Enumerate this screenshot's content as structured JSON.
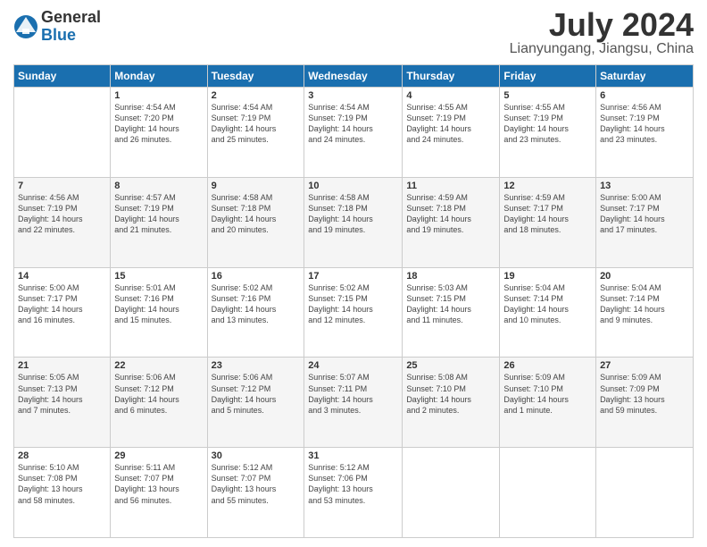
{
  "header": {
    "logo_general": "General",
    "logo_blue": "Blue",
    "title": "July 2024",
    "location": "Lianyungang, Jiangsu, China"
  },
  "days_of_week": [
    "Sunday",
    "Monday",
    "Tuesday",
    "Wednesday",
    "Thursday",
    "Friday",
    "Saturday"
  ],
  "weeks": [
    [
      {
        "num": "",
        "info": ""
      },
      {
        "num": "1",
        "info": "Sunrise: 4:54 AM\nSunset: 7:20 PM\nDaylight: 14 hours\nand 26 minutes."
      },
      {
        "num": "2",
        "info": "Sunrise: 4:54 AM\nSunset: 7:19 PM\nDaylight: 14 hours\nand 25 minutes."
      },
      {
        "num": "3",
        "info": "Sunrise: 4:54 AM\nSunset: 7:19 PM\nDaylight: 14 hours\nand 24 minutes."
      },
      {
        "num": "4",
        "info": "Sunrise: 4:55 AM\nSunset: 7:19 PM\nDaylight: 14 hours\nand 24 minutes."
      },
      {
        "num": "5",
        "info": "Sunrise: 4:55 AM\nSunset: 7:19 PM\nDaylight: 14 hours\nand 23 minutes."
      },
      {
        "num": "6",
        "info": "Sunrise: 4:56 AM\nSunset: 7:19 PM\nDaylight: 14 hours\nand 23 minutes."
      }
    ],
    [
      {
        "num": "7",
        "info": "Sunrise: 4:56 AM\nSunset: 7:19 PM\nDaylight: 14 hours\nand 22 minutes."
      },
      {
        "num": "8",
        "info": "Sunrise: 4:57 AM\nSunset: 7:19 PM\nDaylight: 14 hours\nand 21 minutes."
      },
      {
        "num": "9",
        "info": "Sunrise: 4:58 AM\nSunset: 7:18 PM\nDaylight: 14 hours\nand 20 minutes."
      },
      {
        "num": "10",
        "info": "Sunrise: 4:58 AM\nSunset: 7:18 PM\nDaylight: 14 hours\nand 19 minutes."
      },
      {
        "num": "11",
        "info": "Sunrise: 4:59 AM\nSunset: 7:18 PM\nDaylight: 14 hours\nand 19 minutes."
      },
      {
        "num": "12",
        "info": "Sunrise: 4:59 AM\nSunset: 7:17 PM\nDaylight: 14 hours\nand 18 minutes."
      },
      {
        "num": "13",
        "info": "Sunrise: 5:00 AM\nSunset: 7:17 PM\nDaylight: 14 hours\nand 17 minutes."
      }
    ],
    [
      {
        "num": "14",
        "info": "Sunrise: 5:00 AM\nSunset: 7:17 PM\nDaylight: 14 hours\nand 16 minutes."
      },
      {
        "num": "15",
        "info": "Sunrise: 5:01 AM\nSunset: 7:16 PM\nDaylight: 14 hours\nand 15 minutes."
      },
      {
        "num": "16",
        "info": "Sunrise: 5:02 AM\nSunset: 7:16 PM\nDaylight: 14 hours\nand 13 minutes."
      },
      {
        "num": "17",
        "info": "Sunrise: 5:02 AM\nSunset: 7:15 PM\nDaylight: 14 hours\nand 12 minutes."
      },
      {
        "num": "18",
        "info": "Sunrise: 5:03 AM\nSunset: 7:15 PM\nDaylight: 14 hours\nand 11 minutes."
      },
      {
        "num": "19",
        "info": "Sunrise: 5:04 AM\nSunset: 7:14 PM\nDaylight: 14 hours\nand 10 minutes."
      },
      {
        "num": "20",
        "info": "Sunrise: 5:04 AM\nSunset: 7:14 PM\nDaylight: 14 hours\nand 9 minutes."
      }
    ],
    [
      {
        "num": "21",
        "info": "Sunrise: 5:05 AM\nSunset: 7:13 PM\nDaylight: 14 hours\nand 7 minutes."
      },
      {
        "num": "22",
        "info": "Sunrise: 5:06 AM\nSunset: 7:12 PM\nDaylight: 14 hours\nand 6 minutes."
      },
      {
        "num": "23",
        "info": "Sunrise: 5:06 AM\nSunset: 7:12 PM\nDaylight: 14 hours\nand 5 minutes."
      },
      {
        "num": "24",
        "info": "Sunrise: 5:07 AM\nSunset: 7:11 PM\nDaylight: 14 hours\nand 3 minutes."
      },
      {
        "num": "25",
        "info": "Sunrise: 5:08 AM\nSunset: 7:10 PM\nDaylight: 14 hours\nand 2 minutes."
      },
      {
        "num": "26",
        "info": "Sunrise: 5:09 AM\nSunset: 7:10 PM\nDaylight: 14 hours\nand 1 minute."
      },
      {
        "num": "27",
        "info": "Sunrise: 5:09 AM\nSunset: 7:09 PM\nDaylight: 13 hours\nand 59 minutes."
      }
    ],
    [
      {
        "num": "28",
        "info": "Sunrise: 5:10 AM\nSunset: 7:08 PM\nDaylight: 13 hours\nand 58 minutes."
      },
      {
        "num": "29",
        "info": "Sunrise: 5:11 AM\nSunset: 7:07 PM\nDaylight: 13 hours\nand 56 minutes."
      },
      {
        "num": "30",
        "info": "Sunrise: 5:12 AM\nSunset: 7:07 PM\nDaylight: 13 hours\nand 55 minutes."
      },
      {
        "num": "31",
        "info": "Sunrise: 5:12 AM\nSunset: 7:06 PM\nDaylight: 13 hours\nand 53 minutes."
      },
      {
        "num": "",
        "info": ""
      },
      {
        "num": "",
        "info": ""
      },
      {
        "num": "",
        "info": ""
      }
    ]
  ]
}
